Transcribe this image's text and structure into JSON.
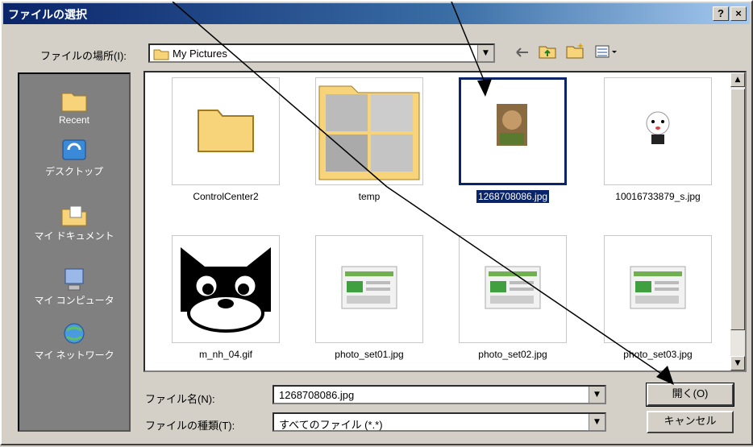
{
  "window": {
    "title": "ファイルの選択",
    "help_btn": "?",
    "close_btn": "×"
  },
  "lookin": {
    "label": "ファイルの場所(I):",
    "value": "My Pictures"
  },
  "places": [
    {
      "label": "Recent",
      "icon": "recent-folder-icon"
    },
    {
      "label": "デスクトップ",
      "icon": "desktop-icon"
    },
    {
      "label": "マイ ドキュメント",
      "icon": "my-documents-icon"
    },
    {
      "label": "マイ コンピュータ",
      "icon": "my-computer-icon"
    },
    {
      "label": "マイ ネットワーク",
      "icon": "my-network-icon"
    }
  ],
  "files": [
    {
      "name": "ControlCenter2",
      "type": "folder"
    },
    {
      "name": "temp",
      "type": "folder-thumbs"
    },
    {
      "name": "1268708086.jpg",
      "type": "photo",
      "selected": true
    },
    {
      "name": "10016733879_s.jpg",
      "type": "character"
    },
    {
      "name": "m_nh_04.gif",
      "type": "cat"
    },
    {
      "name": "photo_set01.jpg",
      "type": "screenshot"
    },
    {
      "name": "photo_set02.jpg",
      "type": "screenshot"
    },
    {
      "name": "photo_set03.jpg",
      "type": "screenshot"
    }
  ],
  "filename": {
    "label": "ファイル名(N):",
    "value": "1268708086.jpg"
  },
  "filetype": {
    "label": "ファイルの種類(T):",
    "value": "すべてのファイル (*.*)"
  },
  "buttons": {
    "open": "開く(O)",
    "cancel": "キャンセル"
  },
  "colors": {
    "title_bar": "#0a246a",
    "selection": "#0a246a",
    "folder": "#f7d47a"
  }
}
